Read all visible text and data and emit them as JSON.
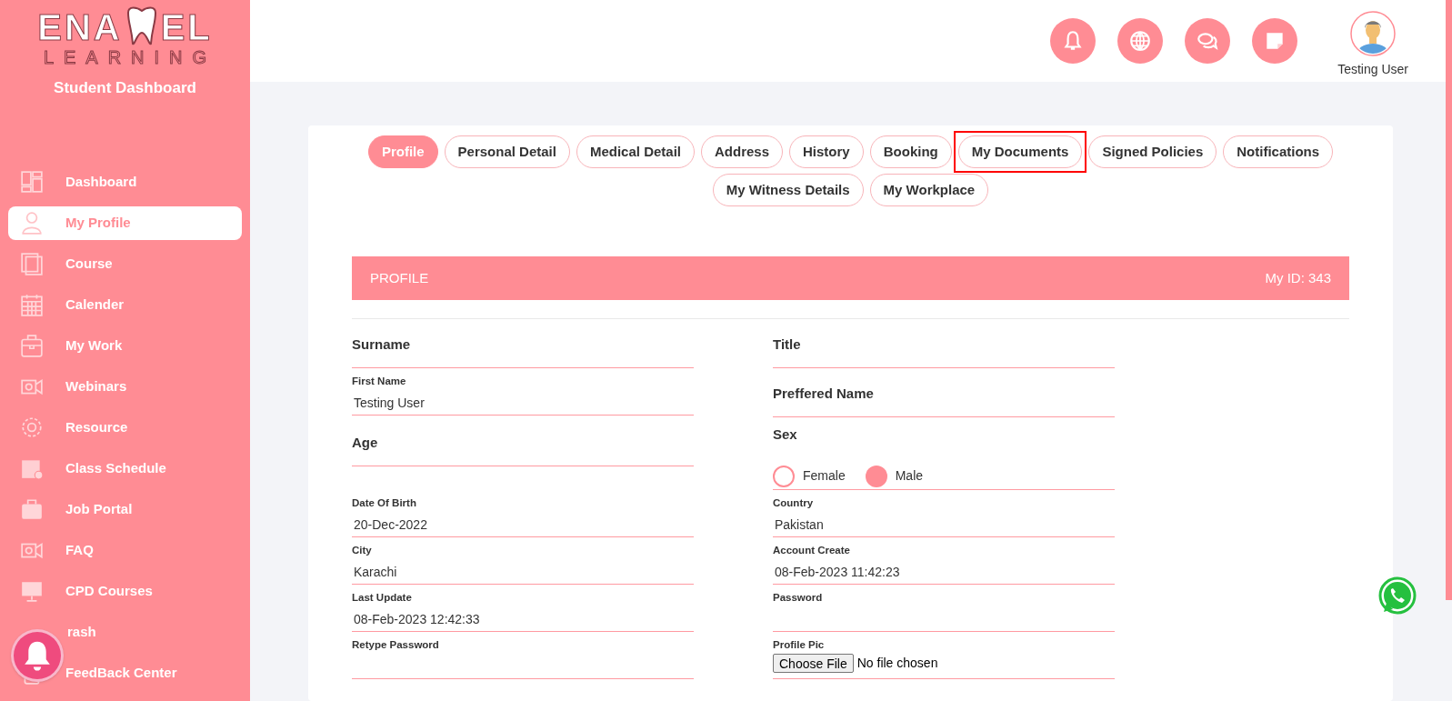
{
  "logo": {
    "left": "ENA",
    "right": "EL",
    "subtitle": "LEARNING"
  },
  "sidebar": {
    "title": "Student Dashboard",
    "items": [
      {
        "label": "Dashboard",
        "selected": false
      },
      {
        "label": "My Profile",
        "selected": true
      },
      {
        "label": "Course",
        "selected": false
      },
      {
        "label": "Calender",
        "selected": false
      },
      {
        "label": "My Work",
        "selected": false
      },
      {
        "label": "Webinars",
        "selected": false
      },
      {
        "label": "Resource",
        "selected": false
      },
      {
        "label": "Class Schedule",
        "selected": false
      },
      {
        "label": "Job Portal",
        "selected": false
      },
      {
        "label": "FAQ",
        "selected": false
      },
      {
        "label": "CPD Courses",
        "selected": false
      },
      {
        "label": "rash",
        "selected": false
      },
      {
        "label": "FeedBack Center",
        "selected": false
      }
    ]
  },
  "header": {
    "user_name": "Testing User"
  },
  "tabs": [
    {
      "label": "Profile",
      "selected": true,
      "highlighted": false
    },
    {
      "label": "Personal Detail",
      "selected": false,
      "highlighted": false
    },
    {
      "label": "Medical Detail",
      "selected": false,
      "highlighted": false
    },
    {
      "label": "Address",
      "selected": false,
      "highlighted": false
    },
    {
      "label": "History",
      "selected": false,
      "highlighted": false
    },
    {
      "label": "Booking",
      "selected": false,
      "highlighted": false
    },
    {
      "label": "My Documents",
      "selected": false,
      "highlighted": true
    },
    {
      "label": "Signed Policies",
      "selected": false,
      "highlighted": false
    },
    {
      "label": "Notifications",
      "selected": false,
      "highlighted": false
    },
    {
      "label": "My Witness Details",
      "selected": false,
      "highlighted": false
    },
    {
      "label": "My Workplace",
      "selected": false,
      "highlighted": false
    }
  ],
  "banner": {
    "title": "PROFILE",
    "id_text": "My ID: 343"
  },
  "form": {
    "rows": [
      [
        {
          "kind": "heading",
          "label": "Surname"
        },
        {
          "kind": "heading",
          "label": "Title"
        }
      ],
      [
        {
          "kind": "labeled",
          "label": "First Name",
          "value": "Testing User"
        },
        {
          "kind": "heading",
          "label": "Preffered Name"
        }
      ],
      [
        {
          "kind": "heading",
          "label": "Age"
        },
        {
          "kind": "radio",
          "label": "Sex",
          "options": [
            {
              "label": "Female",
              "selected": false
            },
            {
              "label": "Male",
              "selected": true
            }
          ]
        }
      ],
      [
        {
          "kind": "labeled",
          "label": "Date Of Birth",
          "value": "20-Dec-2022"
        },
        {
          "kind": "labeled",
          "label": "Country",
          "value": "Pakistan"
        }
      ],
      [
        {
          "kind": "labeled",
          "label": "City",
          "value": "Karachi"
        },
        {
          "kind": "labeled",
          "label": "Account Create",
          "value": "08-Feb-2023 11:42:23"
        }
      ],
      [
        {
          "kind": "labeled",
          "label": "Last Update",
          "value": "08-Feb-2023 12:42:33"
        },
        {
          "kind": "labeled",
          "label": "Password"
        }
      ],
      [
        {
          "kind": "labeled",
          "label": "Retype Password"
        },
        {
          "kind": "file",
          "label": "Profile Pic",
          "button": "Choose File",
          "status": "No file chosen"
        }
      ]
    ]
  }
}
